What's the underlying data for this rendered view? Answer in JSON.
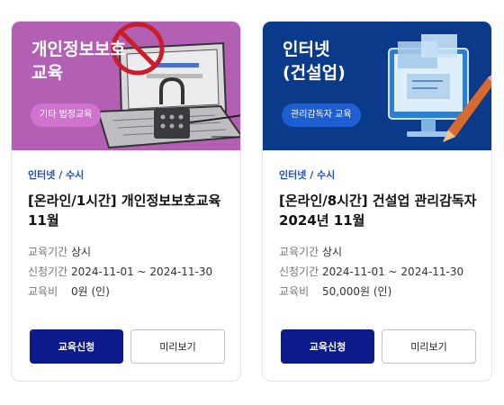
{
  "cards": [
    {
      "thumb_title": "개인정보보호\n교육",
      "tag": "기타 법정교육",
      "category": "인터넷 / 수시",
      "title": "[온라인/1시간] 개인정보보호교육 11월",
      "period_label": "교육기간",
      "period_value": "상시",
      "apply_period_label": "신청기간",
      "apply_period_value": "2024-11-01 ~ 2024-11-30",
      "fee_label": "교육비",
      "fee_value": "0원 (인)",
      "apply_button": "교육신청",
      "preview_button": "미리보기"
    },
    {
      "thumb_title": "인터넷\n(건설업)",
      "tag": "관리감독자 교육",
      "category": "인터넷 / 수시",
      "title": "[온라인/8시간] 건설업 관리감독자 2024년 11월",
      "period_label": "교육기간",
      "period_value": "상시",
      "apply_period_label": "신청기간",
      "apply_period_value": "2024-11-01 ~ 2024-11-30",
      "fee_label": "교육비",
      "fee_value": "50,000원 (인)",
      "apply_button": "교육신청",
      "preview_button": "미리보기"
    }
  ],
  "colors": {
    "card1_banner": "#b360b4",
    "card2_banner": "#0b3a8a",
    "apply_button": "#0d1a8c",
    "category_text": "#1f4fb8"
  }
}
